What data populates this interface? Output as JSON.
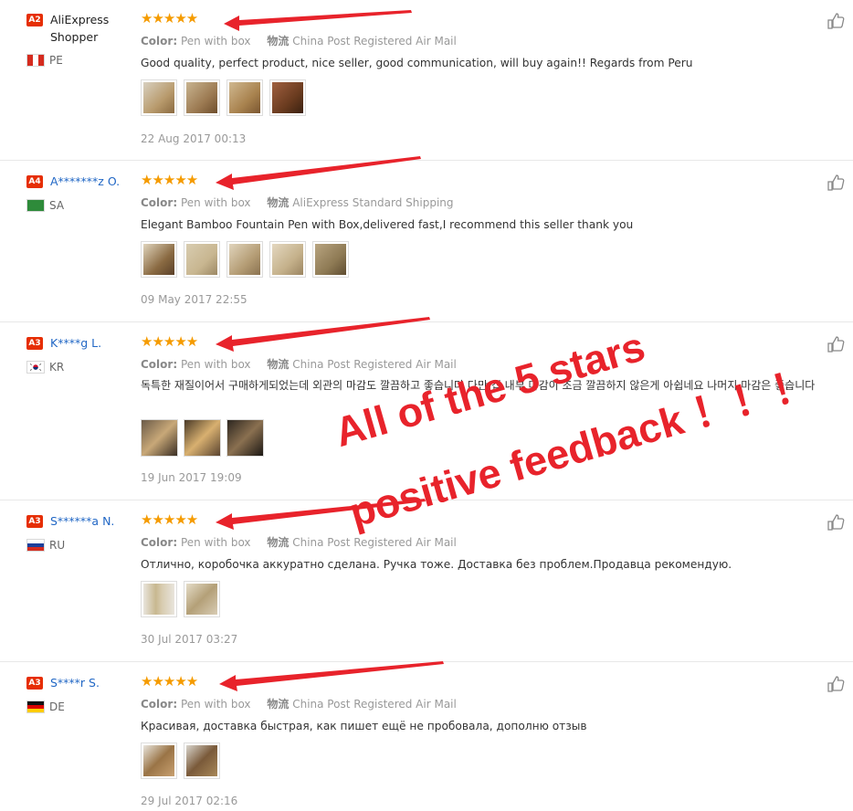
{
  "reviews": [
    {
      "badge": "A2",
      "user": "AliExpress Shopper",
      "user_style": "black",
      "country": "PE",
      "flag": "pe",
      "stars": "★★★★★",
      "color_label": "Color:",
      "color_value": "Pen with box",
      "ship_label": "物流",
      "ship_value": "China Post Registered Air Mail",
      "text": "Good quality, perfect product, nice seller, good communication, will buy again!! Regards from Peru",
      "thumbs": [
        "#b89a6c",
        "#9c7a52",
        "#a8824e",
        "#6a3b1f"
      ],
      "date": "22 Aug 2017 00:13",
      "like_count": "0"
    },
    {
      "badge": "A4",
      "user": "A*******z O.",
      "user_style": "blue",
      "country": "SA",
      "flag": "sa",
      "stars": "★★★★★",
      "color_label": "Color:",
      "color_value": "Pen with box",
      "ship_label": "物流",
      "ship_value": "AliExpress Standard Shipping",
      "text": "Elegant Bamboo Fountain Pen with Box,delivered fast,I recommend this seller thank you",
      "thumbs": [
        "#8a6a42",
        "#c8b690",
        "#b49c74",
        "#c4b08a",
        "#8e7a54"
      ],
      "date": "09 May 2017 22:55",
      "like_count": "0"
    },
    {
      "badge": "A3",
      "user": "K****g L.",
      "user_style": "blue",
      "country": "KR",
      "flag": "kr",
      "stars": "★★★★★",
      "color_label": "Color:",
      "color_value": "Pen with box",
      "ship_label": "物流",
      "ship_value": "China Post Registered Air Mail",
      "text": "독특한 재질이어서 구매하게되었는데 외관의 마감도 깔끔하고 좋습니다 다만 캡 내부 마감이 조금 깔끔하지 않은게 아쉽네요 나머지 마감은 좋습니다",
      "thumbs": [
        "#5a4a3a",
        "#a07a40",
        "#3c3228"
      ],
      "date": "19 Jun 2017 19:09",
      "like_count": "0"
    },
    {
      "badge": "A3",
      "user": "S******a N.",
      "user_style": "blue",
      "country": "RU",
      "flag": "ru",
      "stars": "★★★★★",
      "color_label": "Color:",
      "color_value": "Pen with box",
      "ship_label": "物流",
      "ship_value": "China Post Registered Air Mail",
      "text": "Отлично, коробочка аккуратно сделана. Ручка тоже. Доставка без проблем.Продавца рекомендую.",
      "thumbs": [
        "#c8b890",
        "#b4a078"
      ],
      "date": "30 Jul 2017 03:27",
      "like_count": "0"
    },
    {
      "badge": "A3",
      "user": "S****r S.",
      "user_style": "blue",
      "country": "DE",
      "flag": "de",
      "stars": "★★★★★",
      "color_label": "Color:",
      "color_value": "Pen with box",
      "ship_label": "物流",
      "ship_value": "China Post Registered Air Mail",
      "text": "Красивая, доставка быстрая, как пишет ещё не пробовала, дополню отзыв",
      "thumbs": [
        "#9a7446",
        "#7a5a3a"
      ],
      "date": "29 Jul 2017 02:16",
      "like_count": "0"
    }
  ],
  "overlay": {
    "line1": "All of the 5 stars",
    "line2": "positive feedback ！！！",
    "color": "#e8232b"
  }
}
